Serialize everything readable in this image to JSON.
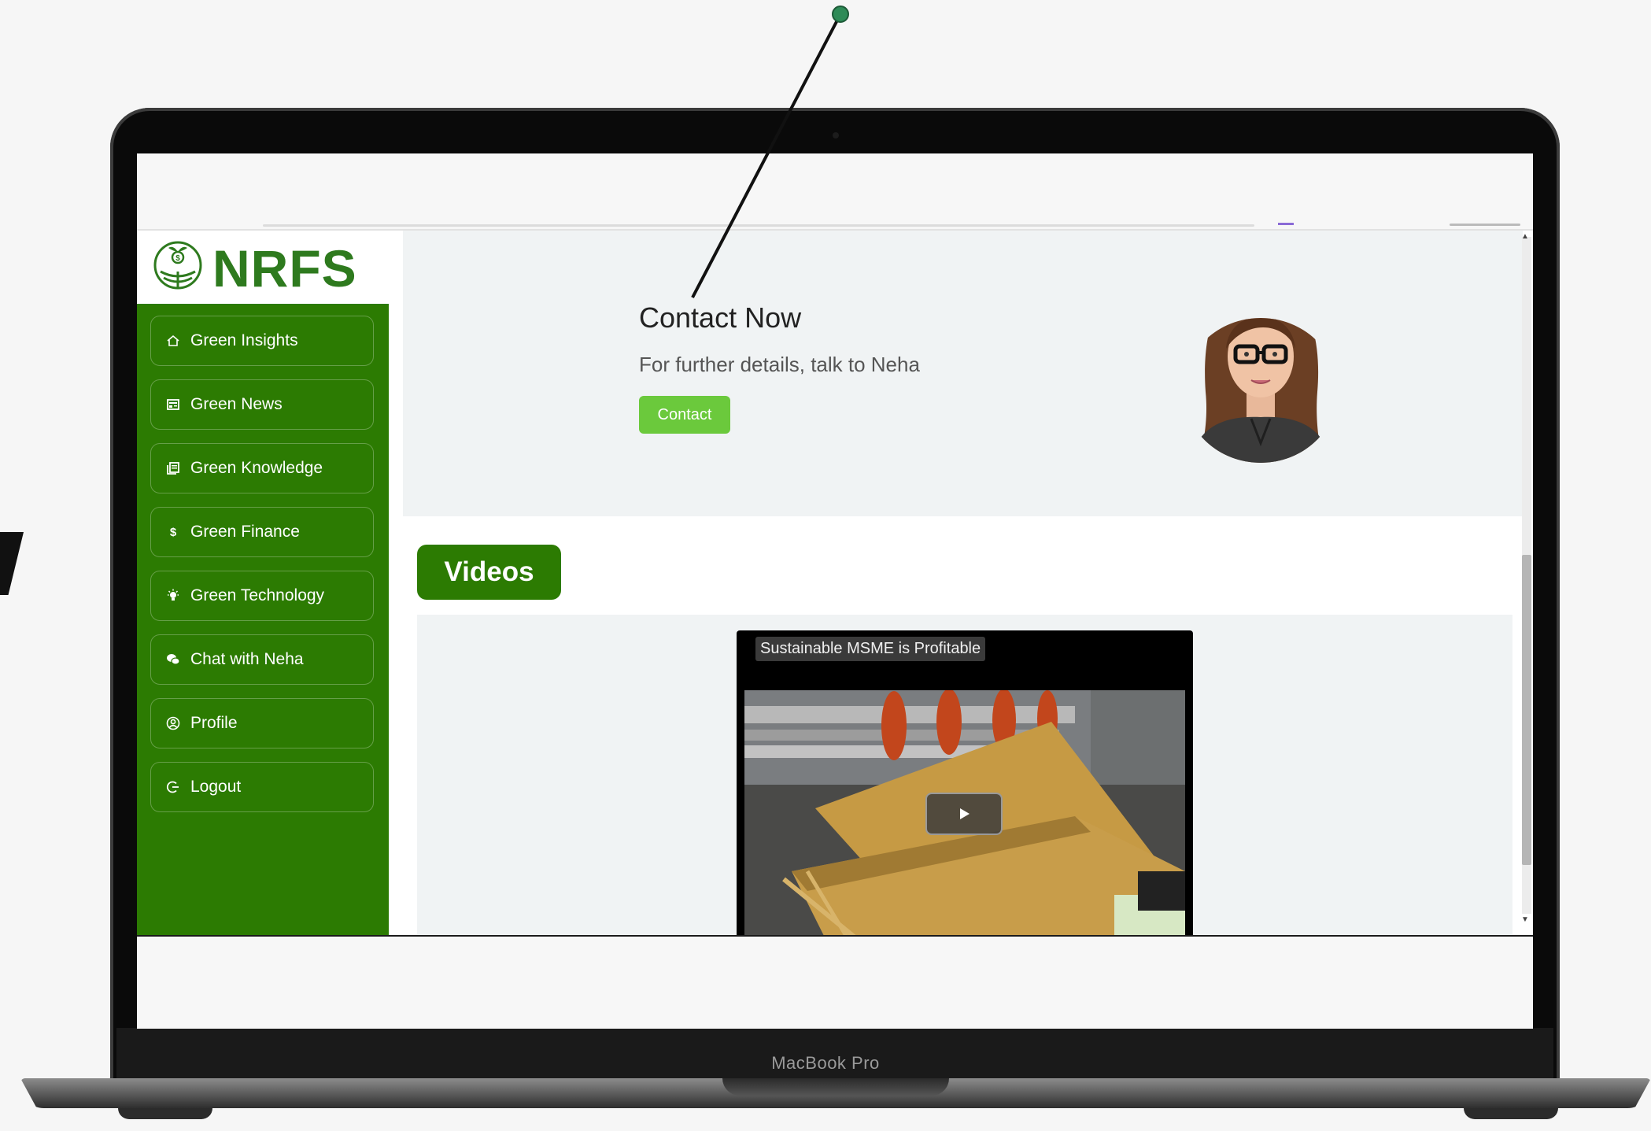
{
  "logo": {
    "text": "NRFS",
    "icon": "globe-plant-logo-icon",
    "color": "#2e7a1e"
  },
  "sidebar": {
    "background": "#2c7b02",
    "items": [
      {
        "label": "Green Insights",
        "icon": "home-icon"
      },
      {
        "label": "Green News",
        "icon": "newspaper-icon"
      },
      {
        "label": "Green Knowledge",
        "icon": "book-icon"
      },
      {
        "label": "Green Finance",
        "icon": "dollar-icon"
      },
      {
        "label": "Green Technology",
        "icon": "lightbulb-icon"
      },
      {
        "label": "Chat with Neha",
        "icon": "chat-icon"
      },
      {
        "label": "Profile",
        "icon": "user-circle-icon"
      },
      {
        "label": "Logout",
        "icon": "logout-icon"
      }
    ]
  },
  "contact": {
    "title": "Contact Now",
    "subtitle": "For further details, talk to Neha",
    "button_label": "Contact",
    "button_color": "#6bc93c"
  },
  "videos": {
    "heading": "Videos",
    "items": [
      {
        "title": "Sustainable MSME is Profitable",
        "icon": "play-icon"
      }
    ]
  },
  "device": {
    "label": "MacBook Pro"
  }
}
